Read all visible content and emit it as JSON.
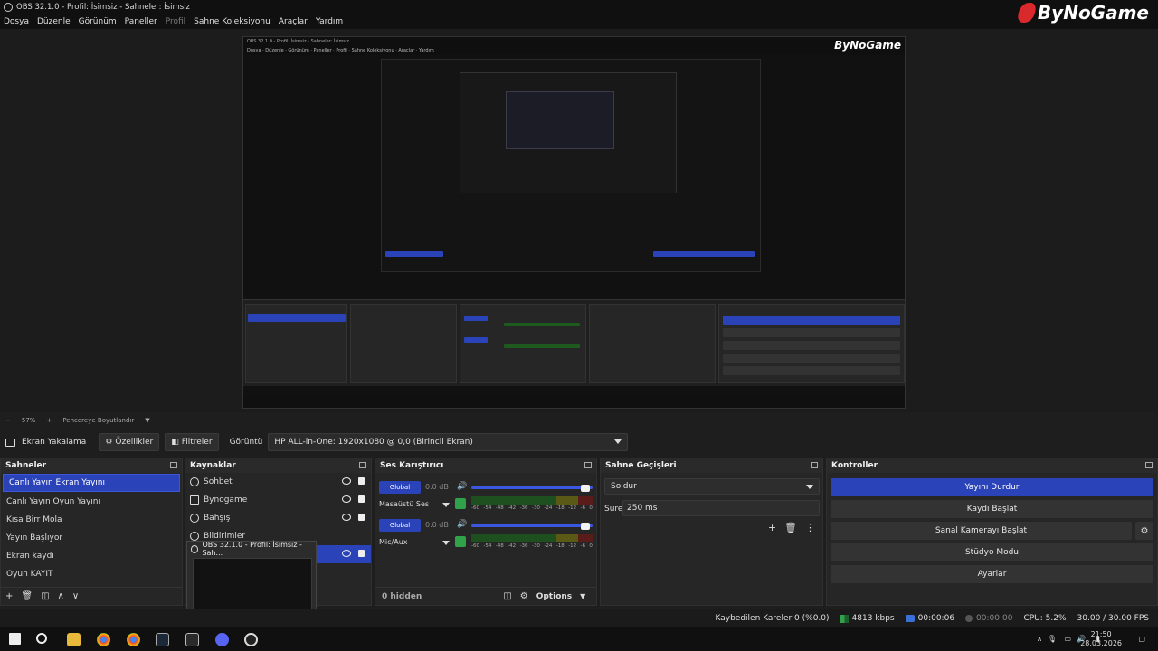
{
  "window": {
    "title": "OBS 32.1.0 - Profil: İsimsiz - Sahneler: İsimsiz"
  },
  "brand": {
    "name": "ByNoGame"
  },
  "menu": [
    {
      "label": "Dosya",
      "enabled": true
    },
    {
      "label": "Düzenle",
      "enabled": true
    },
    {
      "label": "Görünüm",
      "enabled": true
    },
    {
      "label": "Paneller",
      "enabled": true
    },
    {
      "label": "Profil",
      "enabled": false
    },
    {
      "label": "Sahne Koleksiyonu",
      "enabled": true
    },
    {
      "label": "Araçlar",
      "enabled": true
    },
    {
      "label": "Yardım",
      "enabled": true
    }
  ],
  "zoombar": {
    "minus": "−",
    "zoom": "57%",
    "plus": "+",
    "fit": "Pencereye Boyutlandır"
  },
  "toolbar": {
    "source_name": "Ekran Yakalama",
    "properties_label": "Özellikler",
    "filters_label": "Filtreler",
    "display_label": "Görüntü",
    "display_value": "HP ALL-in-One: 1920x1080 @ 0,0 (Birincil Ekran)"
  },
  "scenes": {
    "title": "Sahneler",
    "items": [
      "Canlı Yayın Ekran Yayını",
      "Canlı Yayın Oyun Yayını",
      "Kısa Birr Mola",
      "Yayın Başlıyor",
      "Ekran kaydı",
      "Oyun KAYIT"
    ],
    "selected_index": 0
  },
  "sources": {
    "title": "Kaynaklar",
    "items": [
      "Sohbet",
      "Bynogame",
      "Bahşiş",
      "Bildirimler"
    ]
  },
  "popup": {
    "title": "OBS 32.1.0 - Profil: İsimsiz - Sah..."
  },
  "mixer": {
    "title": "Ses Karıştırıcı",
    "channels": [
      {
        "name": "Masaüstü Ses",
        "db": "0.0 dB",
        "global_label": "Global",
        "volume_pct": 100
      },
      {
        "name": "Mic/Aux",
        "db": "0.0 dB",
        "global_label": "Global",
        "volume_pct": 100
      }
    ],
    "scale": [
      "-60",
      "-54",
      "-48",
      "-42",
      "-36",
      "-30",
      "-24",
      "-18",
      "-12",
      "-6",
      "0"
    ],
    "hidden_label": "0 hidden",
    "options_label": "Options"
  },
  "transitions": {
    "title": "Sahne Geçişleri",
    "selected": "Soldur",
    "duration_label": "Süre",
    "duration_value": "250 ms"
  },
  "controls": {
    "title": "Kontroller",
    "buttons": [
      "Yayını Durdur",
      "Kaydı Başlat",
      "Sanal Kamerayı Başlat",
      "Stüdyo Modu",
      "Ayarlar"
    ]
  },
  "status": {
    "dropped": "Kaybedilen Kareler 0 (%0.0)",
    "bitrate": "4813 kbps",
    "live_time": "00:00:06",
    "rec_time": "00:00:00",
    "cpu": "CPU: 5.2%",
    "fps": "30.00 / 30.00 FPS"
  },
  "taskbar": {
    "time": "21:50",
    "date": "28.03.2026"
  },
  "colors": {
    "accent": "#2b43b9",
    "background": "#1e1e1e",
    "panel": "#262626",
    "meter_green": "#2fa24a"
  }
}
